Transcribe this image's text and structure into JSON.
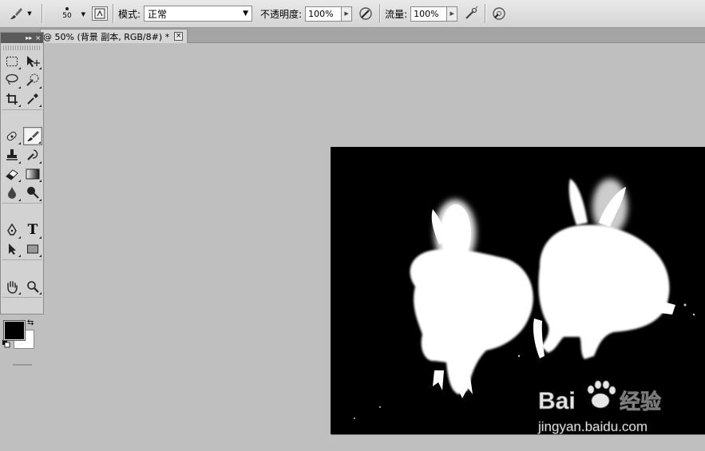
{
  "options_bar": {
    "brush_size": "50",
    "mode_label": "模式:",
    "mode_value": "正常",
    "opacity_label": "不透明度:",
    "opacity_value": "100%",
    "flow_label": "流量:",
    "flow_value": "100%"
  },
  "document_tab": {
    "title": "@ 50% (背景 副本, RGB/8#) *",
    "close_glyph": "×"
  },
  "tools_panel": {
    "collapse_glyph": "▸▸",
    "close_glyph": "×",
    "tools": [
      {
        "name": "marquee-tool-icon"
      },
      {
        "name": "move-tool-icon"
      },
      {
        "name": "lasso-tool-icon"
      },
      {
        "name": "quick-selection-tool-icon"
      },
      {
        "name": "crop-tool-icon"
      },
      {
        "name": "eyedropper-tool-icon"
      },
      {
        "name": "healing-brush-tool-icon"
      },
      {
        "name": "brush-tool-icon",
        "active": true
      },
      {
        "name": "clone-stamp-tool-icon"
      },
      {
        "name": "history-brush-tool-icon"
      },
      {
        "name": "eraser-tool-icon"
      },
      {
        "name": "gradient-tool-icon"
      },
      {
        "name": "blur-tool-icon"
      },
      {
        "name": "dodge-tool-icon"
      },
      {
        "name": "pen-tool-icon"
      },
      {
        "name": "type-tool-icon"
      },
      {
        "name": "path-selection-tool-icon"
      },
      {
        "name": "rectangle-tool-icon"
      },
      {
        "name": "hand-tool-icon"
      },
      {
        "name": "zoom-tool-icon"
      }
    ],
    "type_glyph": "T",
    "foreground_color": "#000000",
    "background_color": "#ffffff"
  },
  "canvas": {
    "background_color": "#000000",
    "subject_color": "#ffffff"
  },
  "watermark": {
    "logo_text": "Bai",
    "logo_suffix": "经验",
    "url": "jingyan.baidu.com"
  }
}
